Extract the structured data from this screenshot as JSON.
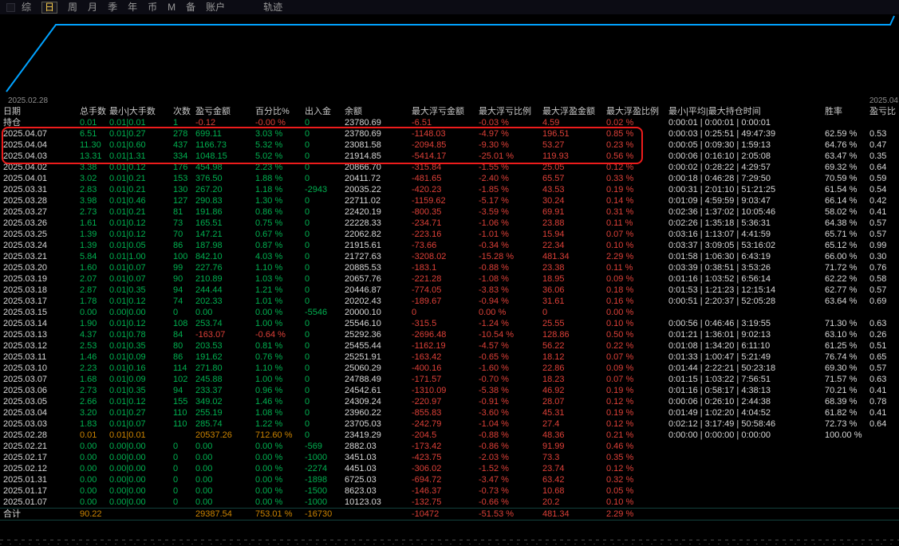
{
  "menu": {
    "items": [
      {
        "id": "zong",
        "label": "综",
        "selected": false
      },
      {
        "id": "ri",
        "label": "日",
        "selected": true
      },
      {
        "id": "zhou",
        "label": "周",
        "selected": false
      },
      {
        "id": "yue",
        "label": "月",
        "selected": false
      },
      {
        "id": "ji",
        "label": "季",
        "selected": false
      },
      {
        "id": "nian",
        "label": "年",
        "selected": false
      },
      {
        "id": "bi",
        "label": "币",
        "selected": false
      },
      {
        "id": "m",
        "label": "M",
        "selected": false
      },
      {
        "id": "bei",
        "label": "备",
        "selected": false
      },
      {
        "id": "zhanghu",
        "label": "账户",
        "selected": false
      }
    ],
    "right_item": "轨迹"
  },
  "chart": {
    "type": "line",
    "start_label": "2025.02.28",
    "end_label": "2025.04",
    "line_color": "#00a2ff",
    "shape": "steep rise from bottom-left then flat plateau to right edge with small uptick at far right"
  },
  "colors": {
    "background": "#000000",
    "positive": "#00b050",
    "negative": "#dd4038",
    "amber": "#cc8400",
    "text": "#d8d8d8",
    "chart_line": "#00a2ff",
    "highlight_border": "#ee1c1c",
    "menu_selected": "#ffd24d"
  },
  "table": {
    "headers": [
      "日期",
      "总手数",
      "最小|大手数",
      "次数",
      "盈亏金额",
      "百分比%",
      "出入金",
      "余额",
      "最大浮亏金额",
      "最大浮亏比例",
      "最大浮盈金额",
      "最大浮盈比例",
      "最小|平均|最大持仓时间",
      "胜率",
      "盈亏比"
    ],
    "position_row": [
      "持仓",
      "0.01",
      "0.01|0.01",
      "1",
      "-0.12",
      "-0.00 %",
      "0",
      "23780.69",
      "-6.51",
      "-0.03 %",
      "4.59",
      "0.02 %",
      "0:00:01 | 0:00:01 | 0:00:01",
      "",
      ""
    ],
    "amber_row_index": 27,
    "rows": [
      [
        "2025.04.07",
        "6.51",
        "0.01|0.27",
        "278",
        "699.11",
        "3.03 %",
        "0",
        "23780.69",
        "-1148.03",
        "-4.97 %",
        "196.51",
        "0.85 %",
        "0:00:03 | 0:25:51 | 49:47:39",
        "62.59 %",
        "0.53"
      ],
      [
        "2025.04.04",
        "11.30",
        "0.01|0.60",
        "437",
        "1166.73",
        "5.32 %",
        "0",
        "23081.58",
        "-2094.85",
        "-9.30 %",
        "53.27",
        "0.23 %",
        "0:00:05 | 0:09:30 | 1:59:13",
        "64.76 %",
        "0.47"
      ],
      [
        "2025.04.03",
        "13.31",
        "0.01|1.31",
        "334",
        "1048.15",
        "5.02 %",
        "0",
        "21914.85",
        "-5414.17",
        "-25.01 %",
        "119.93",
        "0.56 %",
        "0:00:06 | 0:16:10 | 2:05:08",
        "63.47 %",
        "0.35"
      ],
      [
        "2025.04.02",
        "3.38",
        "0.01|0.12",
        "176",
        "454.98",
        "2.23 %",
        "0",
        "20866.70",
        "-315.84",
        "-1.55 %",
        "25.05",
        "0.12 %",
        "0:00:02 | 0:28:22 | 4:29:57",
        "69.32 %",
        "0.64"
      ],
      [
        "2025.04.01",
        "3.02",
        "0.01|0.21",
        "153",
        "376.50",
        "1.88 %",
        "0",
        "20411.72",
        "-481.65",
        "-2.40 %",
        "65.57",
        "0.33 %",
        "0:00:18 | 0:46:28 | 7:29:50",
        "70.59 %",
        "0.59"
      ],
      [
        "2025.03.31",
        "2.83",
        "0.01|0.21",
        "130",
        "267.20",
        "1.18 %",
        "-2943",
        "20035.22",
        "-420.23",
        "-1.85 %",
        "43.53",
        "0.19 %",
        "0:00:31 | 2:01:10 | 51:21:25",
        "61.54 %",
        "0.54"
      ],
      [
        "2025.03.28",
        "3.98",
        "0.01|0.46",
        "127",
        "290.83",
        "1.30 %",
        "0",
        "22711.02",
        "-1159.62",
        "-5.17 %",
        "30.24",
        "0.14 %",
        "0:01:09 | 4:59:59 | 9:03:47",
        "66.14 %",
        "0.42"
      ],
      [
        "2025.03.27",
        "2.73",
        "0.01|0.21",
        "81",
        "191.86",
        "0.86 %",
        "0",
        "22420.19",
        "-800.35",
        "-3.59 %",
        "69.91",
        "0.31 %",
        "0:02:36 | 1:37:02 | 10:05:46",
        "58.02 %",
        "0.41"
      ],
      [
        "2025.03.26",
        "1.61",
        "0.01|0.12",
        "73",
        "165.51",
        "0.75 %",
        "0",
        "22228.33",
        "-234.71",
        "-1.06 %",
        "23.88",
        "0.11 %",
        "0:02:26 | 1:35:18 | 5:36:31",
        "64.38 %",
        "0.57"
      ],
      [
        "2025.03.25",
        "1.39",
        "0.01|0.12",
        "70",
        "147.21",
        "0.67 %",
        "0",
        "22062.82",
        "-223.16",
        "-1.01 %",
        "15.94",
        "0.07 %",
        "0:03:16 | 1:13:07 | 4:41:59",
        "65.71 %",
        "0.57"
      ],
      [
        "2025.03.24",
        "1.39",
        "0.01|0.05",
        "86",
        "187.98",
        "0.87 %",
        "0",
        "21915.61",
        "-73.66",
        "-0.34 %",
        "22.34",
        "0.10 %",
        "0:03:37 | 3:09:05 | 53:16:02",
        "65.12 %",
        "0.99"
      ],
      [
        "2025.03.21",
        "5.84",
        "0.01|1.00",
        "100",
        "842.10",
        "4.03 %",
        "0",
        "21727.63",
        "-3208.02",
        "-15.28 %",
        "481.34",
        "2.29 %",
        "0:01:58 | 1:06:30 | 6:43:19",
        "66.00 %",
        "0.30"
      ],
      [
        "2025.03.20",
        "1.60",
        "0.01|0.07",
        "99",
        "227.76",
        "1.10 %",
        "0",
        "20885.53",
        "-183.1",
        "-0.88 %",
        "23.38",
        "0.11 %",
        "0:03:39 | 0:38:51 | 3:53:26",
        "71.72 %",
        "0.76"
      ],
      [
        "2025.03.19",
        "2.07",
        "0.01|0.07",
        "90",
        "210.89",
        "1.03 %",
        "0",
        "20657.76",
        "-221.28",
        "-1.08 %",
        "18.95",
        "0.09 %",
        "0:01:16 | 1:03:52 | 6:56:14",
        "62.22 %",
        "0.58"
      ],
      [
        "2025.03.18",
        "2.87",
        "0.01|0.35",
        "94",
        "244.44",
        "1.21 %",
        "0",
        "20446.87",
        "-774.05",
        "-3.83 %",
        "36.06",
        "0.18 %",
        "0:01:53 | 1:21:23 | 12:15:14",
        "62.77 %",
        "0.57"
      ],
      [
        "2025.03.17",
        "1.78",
        "0.01|0.12",
        "74",
        "202.33",
        "1.01 %",
        "0",
        "20202.43",
        "-189.67",
        "-0.94 %",
        "31.61",
        "0.16 %",
        "0:00:51 | 2:20:37 | 52:05:28",
        "63.64 %",
        "0.69"
      ],
      [
        "2025.03.15",
        "0.00",
        "0.00|0.00",
        "0",
        "0.00",
        "0.00 %",
        "-5546",
        "20000.10",
        "0",
        "0.00 %",
        "0",
        "0.00 %",
        "",
        "",
        ""
      ],
      [
        "2025.03.14",
        "1.90",
        "0.01|0.12",
        "108",
        "253.74",
        "1.00 %",
        "0",
        "25546.10",
        "-315.5",
        "-1.24 %",
        "25.55",
        "0.10 %",
        "0:00:56 | 0:46:46 | 3:19:55",
        "71.30 %",
        "0.63"
      ],
      [
        "2025.03.13",
        "4.37",
        "0.01|0.78",
        "84",
        "-163.07",
        "-0.64 %",
        "0",
        "25292.36",
        "-2696.48",
        "-10.54 %",
        "128.86",
        "0.50 %",
        "0:01:21 | 1:36:01 | 9:02:13",
        "63.10 %",
        "0.26"
      ],
      [
        "2025.03.12",
        "2.53",
        "0.01|0.35",
        "80",
        "203.53",
        "0.81 %",
        "0",
        "25455.44",
        "-1162.19",
        "-4.57 %",
        "56.22",
        "0.22 %",
        "0:01:08 | 1:34:20 | 6:11:10",
        "61.25 %",
        "0.51"
      ],
      [
        "2025.03.11",
        "1.46",
        "0.01|0.09",
        "86",
        "191.62",
        "0.76 %",
        "0",
        "25251.91",
        "-163.42",
        "-0.65 %",
        "18.12",
        "0.07 %",
        "0:01:33 | 1:00:47 | 5:21:49",
        "76.74 %",
        "0.65"
      ],
      [
        "2025.03.10",
        "2.23",
        "0.01|0.16",
        "114",
        "271.80",
        "1.10 %",
        "0",
        "25060.29",
        "-400.16",
        "-1.60 %",
        "22.86",
        "0.09 %",
        "0:01:44 | 2:22:21 | 50:23:18",
        "69.30 %",
        "0.57"
      ],
      [
        "2025.03.07",
        "1.68",
        "0.01|0.09",
        "102",
        "245.88",
        "1.00 %",
        "0",
        "24788.49",
        "-171.57",
        "-0.70 %",
        "18.23",
        "0.07 %",
        "0:01:15 | 1:03:22 | 7:56:51",
        "71.57 %",
        "0.63"
      ],
      [
        "2025.03.06",
        "2.73",
        "0.01|0.35",
        "94",
        "233.37",
        "0.96 %",
        "0",
        "24542.61",
        "-1310.09",
        "-5.38 %",
        "46.92",
        "0.19 %",
        "0:01:16 | 0:58:17 | 4:38:13",
        "70.21 %",
        "0.41"
      ],
      [
        "2025.03.05",
        "2.66",
        "0.01|0.12",
        "155",
        "349.02",
        "1.46 %",
        "0",
        "24309.24",
        "-220.97",
        "-0.91 %",
        "28.07",
        "0.12 %",
        "0:00:06 | 0:26:10 | 2:44:38",
        "68.39 %",
        "0.78"
      ],
      [
        "2025.03.04",
        "3.20",
        "0.01|0.27",
        "110",
        "255.19",
        "1.08 %",
        "0",
        "23960.22",
        "-855.83",
        "-3.60 %",
        "45.31",
        "0.19 %",
        "0:01:49 | 1:02:20 | 4:04:52",
        "61.82 %",
        "0.41"
      ],
      [
        "2025.03.03",
        "1.83",
        "0.01|0.07",
        "110",
        "285.74",
        "1.22 %",
        "0",
        "23705.03",
        "-242.79",
        "-1.04 %",
        "27.4",
        "0.12 %",
        "0:02:12 | 3:17:49 | 50:58:46",
        "72.73 %",
        "0.64"
      ],
      [
        "2025.02.28",
        "0.01",
        "0.01|0.01",
        "",
        "20537.26",
        "712.60 %",
        "0",
        "23419.29",
        "-204.5",
        "-0.88 %",
        "48.36",
        "0.21 %",
        "0:00:00 | 0:00:00 | 0:00:00",
        "100.00 %",
        ""
      ],
      [
        "2025.02.21",
        "0.00",
        "0.00|0.00",
        "0",
        "0.00",
        "0.00 %",
        "-569",
        "2882.03",
        "-173.42",
        "-0.86 %",
        "91.99",
        "0.46 %",
        "",
        "",
        ""
      ],
      [
        "2025.02.17",
        "0.00",
        "0.00|0.00",
        "0",
        "0.00",
        "0.00 %",
        "-1000",
        "3451.03",
        "-423.75",
        "-2.03 %",
        "73.3",
        "0.35 %",
        "",
        "",
        ""
      ],
      [
        "2025.02.12",
        "0.00",
        "0.00|0.00",
        "0",
        "0.00",
        "0.00 %",
        "-2274",
        "4451.03",
        "-306.02",
        "-1.52 %",
        "23.74",
        "0.12 %",
        "",
        "",
        ""
      ],
      [
        "2025.01.31",
        "0.00",
        "0.00|0.00",
        "0",
        "0.00",
        "0.00 %",
        "-1898",
        "6725.03",
        "-694.72",
        "-3.47 %",
        "63.42",
        "0.32 %",
        "",
        "",
        ""
      ],
      [
        "2025.01.17",
        "0.00",
        "0.00|0.00",
        "0",
        "0.00",
        "0.00 %",
        "-1500",
        "8623.03",
        "-146.37",
        "-0.73 %",
        "10.68",
        "0.05 %",
        "",
        "",
        ""
      ],
      [
        "2025.01.07",
        "0.00",
        "0.00|0.00",
        "0",
        "0.00",
        "0.00 %",
        "-1000",
        "10123.03",
        "-132.75",
        "-0.66 %",
        "20.2",
        "0.10 %",
        "",
        "",
        ""
      ]
    ],
    "total_row": [
      "合计",
      "90.22",
      "",
      "",
      "29387.54",
      "753.01 %",
      "-16730",
      "",
      "-10472",
      "-51.53 %",
      "481.34",
      "2.29 %",
      "",
      "",
      ""
    ]
  }
}
